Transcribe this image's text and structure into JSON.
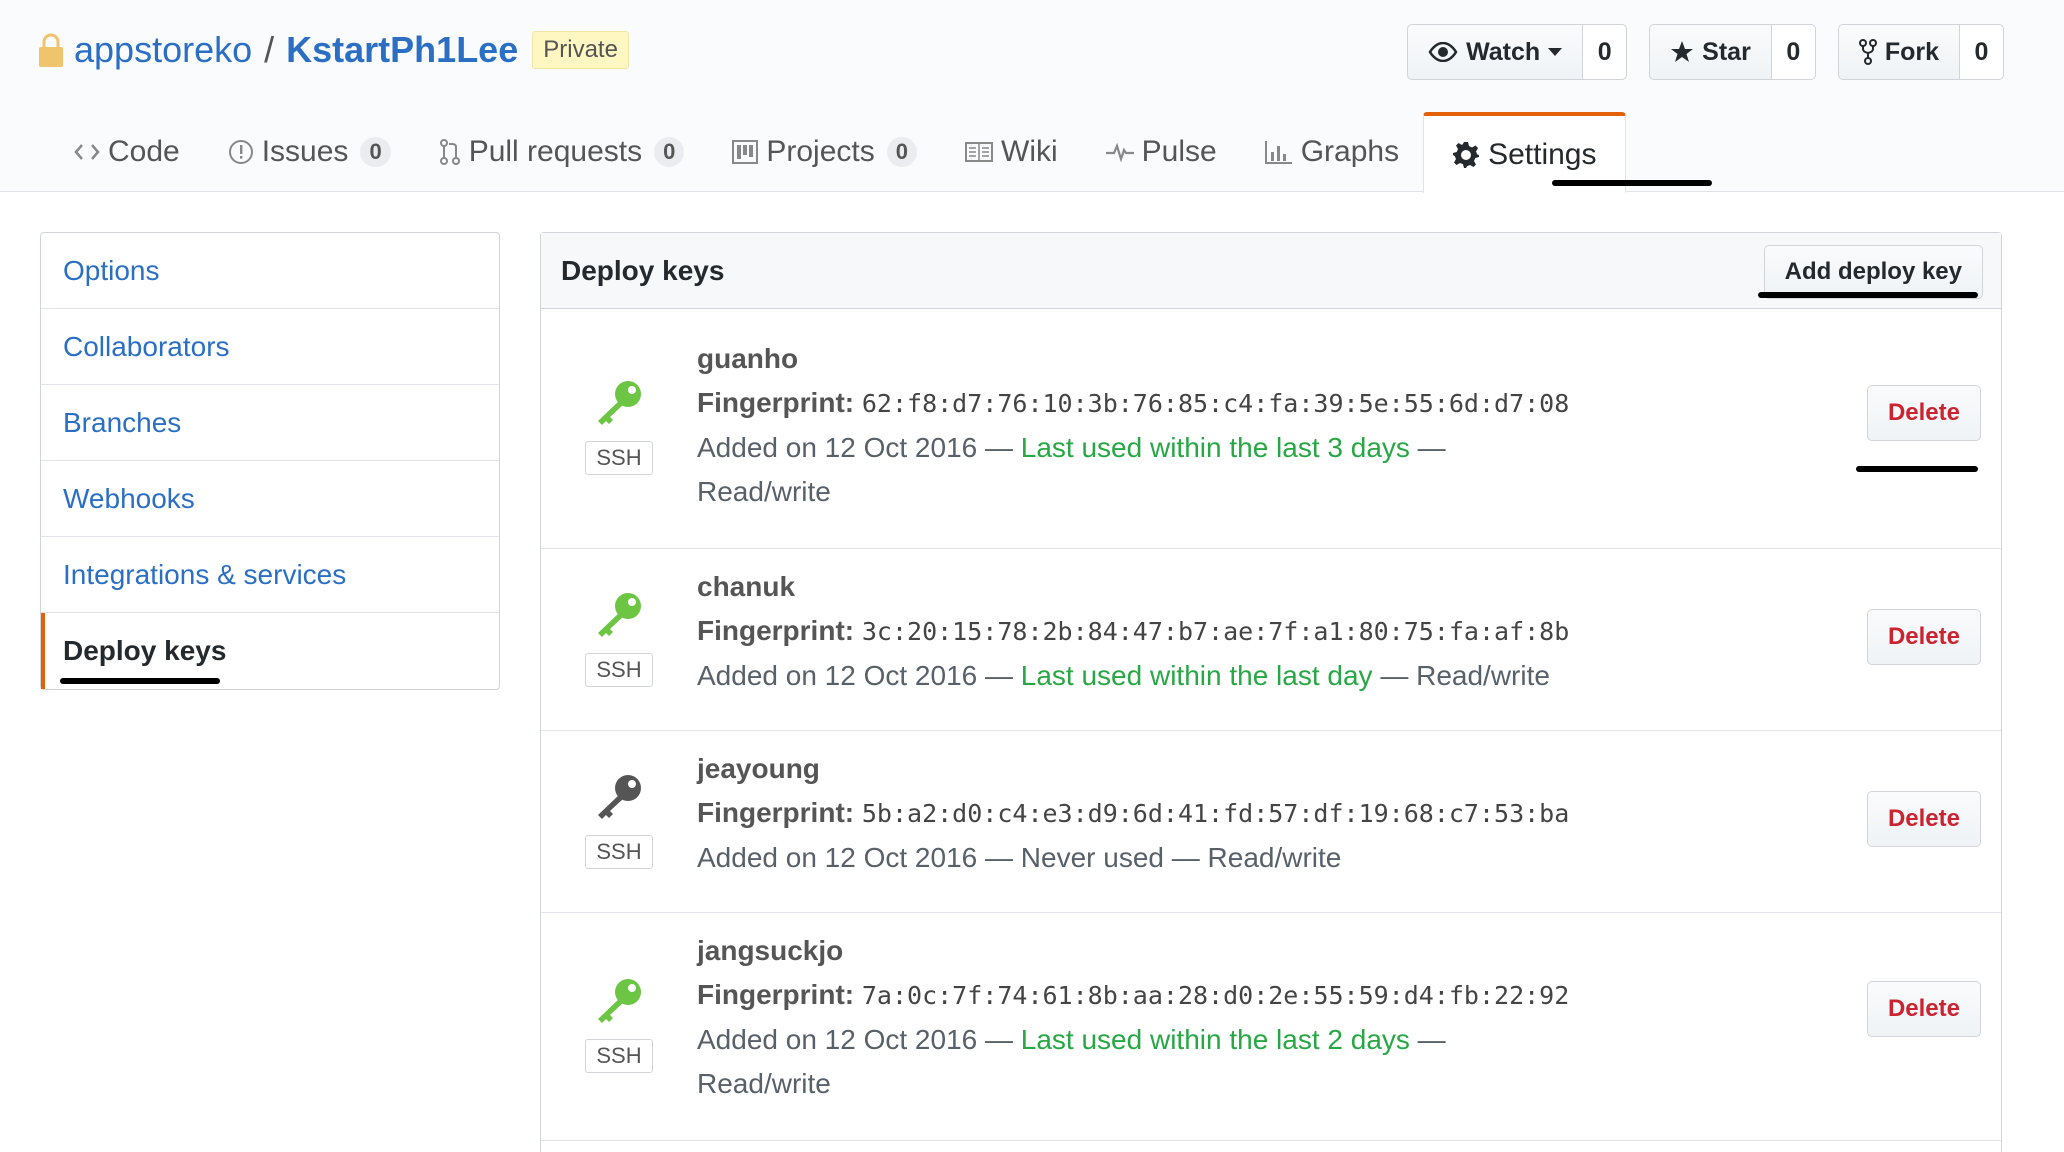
{
  "repo": {
    "owner": "appstoreko",
    "separator": "/",
    "name": "KstartPh1Lee",
    "visibility": "Private"
  },
  "actions": {
    "watch_label": "Watch",
    "watch_count": "0",
    "star_label": "Star",
    "star_count": "0",
    "fork_label": "Fork",
    "fork_count": "0"
  },
  "nav": {
    "code": "Code",
    "issues": "Issues",
    "issues_count": "0",
    "pulls": "Pull requests",
    "pulls_count": "0",
    "projects": "Projects",
    "projects_count": "0",
    "wiki": "Wiki",
    "pulse": "Pulse",
    "graphs": "Graphs",
    "settings": "Settings",
    "selected": "settings"
  },
  "sidebar": {
    "items": [
      {
        "label": "Options"
      },
      {
        "label": "Collaborators"
      },
      {
        "label": "Branches"
      },
      {
        "label": "Webhooks"
      },
      {
        "label": "Integrations & services"
      },
      {
        "label": "Deploy keys"
      }
    ],
    "selected_index": 5
  },
  "deploy_keys": {
    "title": "Deploy keys",
    "add_button": "Add deploy key",
    "fingerprint_label": "Fingerprint:",
    "type_label": "SSH",
    "delete_label": "Delete",
    "keys": [
      {
        "name": "guanho",
        "fingerprint": "62:f8:d7:76:10:3b:76:85:c4:fa:39:5e:55:6d:d7:08",
        "added": "Added on 12 Oct 2016 — ",
        "last_used": "Last used within the last 3 days",
        "after": " — ",
        "access": "Read/write",
        "icon_color": "#6cc644"
      },
      {
        "name": "chanuk",
        "fingerprint": "3c:20:15:78:2b:84:47:b7:ae:7f:a1:80:75:fa:af:8b",
        "added": "Added on 12 Oct 2016 — ",
        "last_used": "Last used within the last day",
        "after": " — ",
        "access": "Read/write",
        "icon_color": "#6cc644"
      },
      {
        "name": "jeayoung",
        "fingerprint": "5b:a2:d0:c4:e3:d9:6d:41:fd:57:df:19:68:c7:53:ba",
        "added": "Added on 12 Oct 2016 — ",
        "last_used": "Never used",
        "after": " — ",
        "access": "Read/write",
        "icon_color": "#555555"
      },
      {
        "name": "jangsuckjo",
        "fingerprint": "7a:0c:7f:74:61:8b:aa:28:d0:2e:55:59:d4:fb:22:92",
        "added": "Added on 12 Oct 2016 — ",
        "last_used": "Last used within the last 2 days",
        "after": " — ",
        "access": "Read/write",
        "icon_color": "#6cc644"
      }
    ]
  },
  "colors": {
    "link": "#2a6fc4",
    "accent": "#e36209",
    "recent_green": "#28a745",
    "danger": "#cb2431"
  }
}
